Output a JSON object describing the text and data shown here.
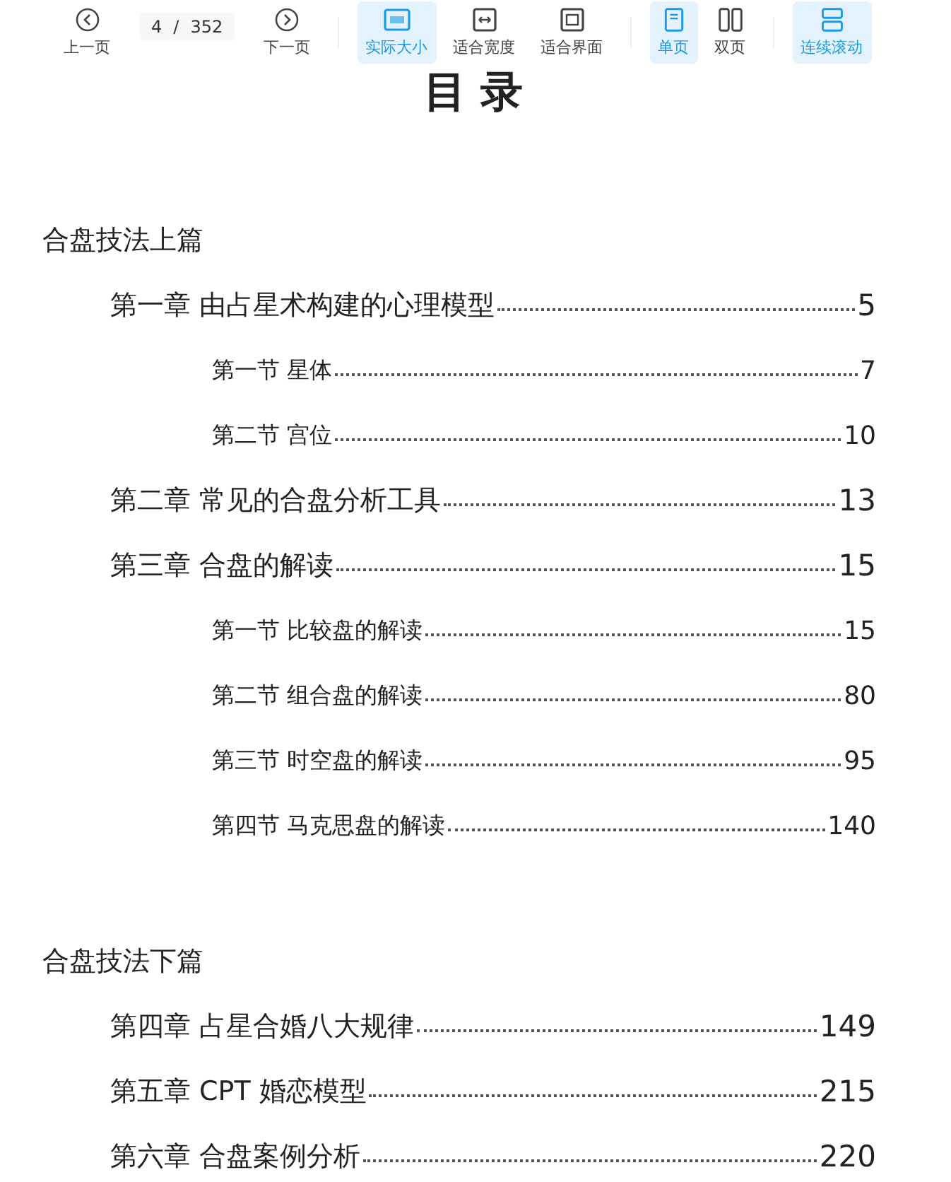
{
  "toolbar": {
    "prev": {
      "label": "上一页"
    },
    "page_field": {
      "value": "4",
      "separator": "/",
      "total": "352"
    },
    "next": {
      "label": "下一页"
    },
    "zoom_modes": [
      {
        "kind": "actual",
        "label": "实际大小",
        "selected": true
      },
      {
        "kind": "width",
        "label": "适合宽度",
        "selected": false
      },
      {
        "kind": "fit",
        "label": "适合界面",
        "selected": false
      }
    ],
    "page_modes": [
      {
        "kind": "single",
        "label": "单页",
        "selected": true
      },
      {
        "kind": "double",
        "label": "双页",
        "selected": false
      }
    ],
    "scroll_modes": [
      {
        "kind": "continuous",
        "label": "连续滚动",
        "selected": true
      }
    ]
  },
  "document": {
    "title": "目 录",
    "parts": [
      {
        "title": "合盘技法上篇",
        "children": [
          {
            "title": "第一章 由占星术构建的心理模型",
            "page": "5",
            "children": [
              {
                "title": "第一节 星体",
                "page": "7"
              },
              {
                "title": "第二节 宫位",
                "page": "10"
              }
            ]
          },
          {
            "title": "第二章 常见的合盘分析工具",
            "page": "13"
          },
          {
            "title": "第三章 合盘的解读",
            "page": "15",
            "children": [
              {
                "title": "第一节 比较盘的解读",
                "page": "15"
              },
              {
                "title": "第二节 组合盘的解读",
                "page": "80"
              },
              {
                "title": "第三节 时空盘的解读",
                "page": "95"
              },
              {
                "title": "第四节 马克思盘的解读",
                "page": "140"
              }
            ]
          }
        ]
      },
      {
        "title": "合盘技法下篇",
        "children": [
          {
            "title": "第四章 占星合婚八大规律",
            "page": "149"
          },
          {
            "title": "第五章 CPT 婚恋模型",
            "page": "215"
          },
          {
            "title": "第六章 合盘案例分析",
            "page": "220"
          }
        ]
      }
    ]
  }
}
